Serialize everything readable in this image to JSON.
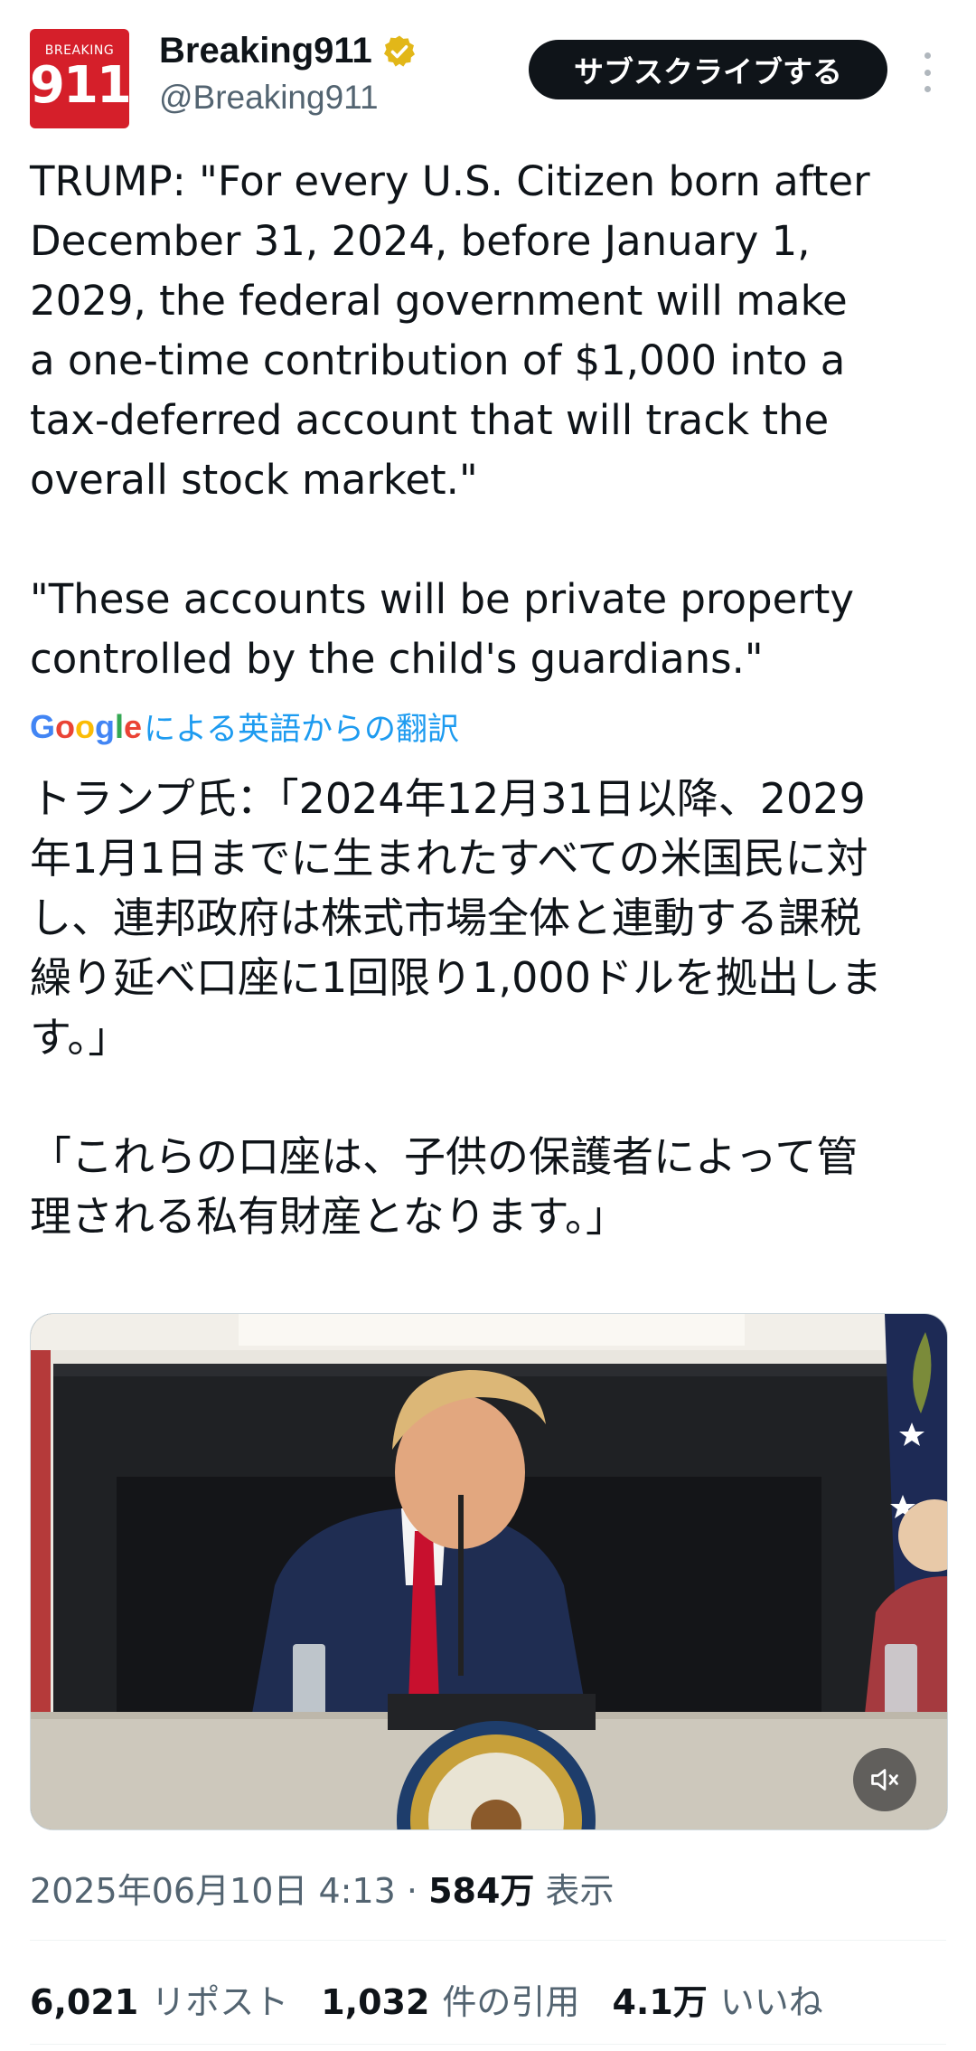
{
  "account": {
    "avatar_top": "BREAKING",
    "avatar_num": "911",
    "display_name": "Breaking911",
    "handle": "@Breaking911",
    "verified": true
  },
  "header": {
    "subscribe_label": "サブスクライブする",
    "more_icon": "more-vertical-icon"
  },
  "tweet": {
    "text": "TRUMP: \"For every U.S. Citizen born after\nDecember 31, 2024, before January 1,\n2029, the federal government will make\na one-time contribution of $1,000 into a\ntax-deferred account that will track the\noverall stock market.\"\n\n\"These accounts will be private property\ncontrolled by the child's guardians.\"",
    "translation_label": "による英語からの翻訳",
    "translation_brand": "Google",
    "translated_text": "トランプ氏：「2024年12月31日以降、2029\n年1月1日までに生まれたすべての米国民に対\nし、連邦政府は株式市場全体と連動する課税\n繰り延べ口座に1回限り1,000ドルを拠出しま\nす。」\n\n「これらの口座は、子供の保護者によって管\n理される私有財産となります。」"
  },
  "media": {
    "type": "video",
    "mute_icon": "volume-muted-icon"
  },
  "meta": {
    "date": "2025年06月10日 4:13",
    "separator": "·",
    "views": "584万",
    "views_label": "表示"
  },
  "stats": [
    {
      "count": "6,021",
      "label": "リポスト"
    },
    {
      "count": "1,032",
      "label": "件の引用"
    },
    {
      "count": "4.1万",
      "label": "いいね"
    }
  ],
  "colors": {
    "accent": "#1d9bf0",
    "text": "#0f1419",
    "muted": "#536471",
    "avatar_bg": "#d51f2a",
    "verified": "#e2b719"
  }
}
